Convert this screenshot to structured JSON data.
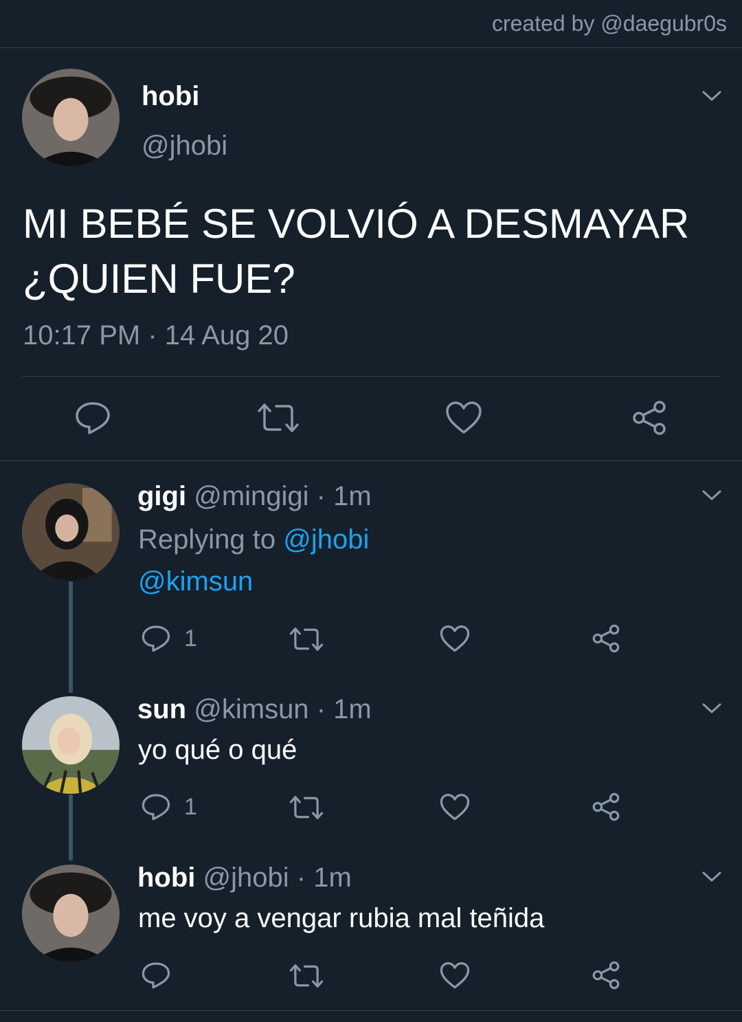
{
  "credit": "created by @daegubr0s",
  "main_tweet": {
    "display_name": "hobi",
    "handle": "@jhobi",
    "text_line1": "MI BEBÉ SE VOLVIÓ A DESMAYAR",
    "text_line2": "¿QUIEN FUE?",
    "timestamp": "10:17 PM · 14 Aug 20"
  },
  "replies": [
    {
      "display_name": "gigi",
      "handle": "@mingigi",
      "time": "· 1m",
      "replying_prefix": "Replying to",
      "replying_to": "@jhobi",
      "text": "@kimsun",
      "reply_count": "1"
    },
    {
      "display_name": "sun",
      "handle": "@kimsun",
      "time": "· 1m",
      "text": "yo qué o qué",
      "reply_count": "1"
    },
    {
      "display_name": "hobi",
      "handle": "@jhobi",
      "time": "· 1m",
      "text": "me voy a vengar rubia mal teñida",
      "reply_count": ""
    }
  ],
  "colors": {
    "background": "#15202b",
    "muted": "#8899a6",
    "link": "#1da1f2",
    "divider": "#38444d"
  }
}
